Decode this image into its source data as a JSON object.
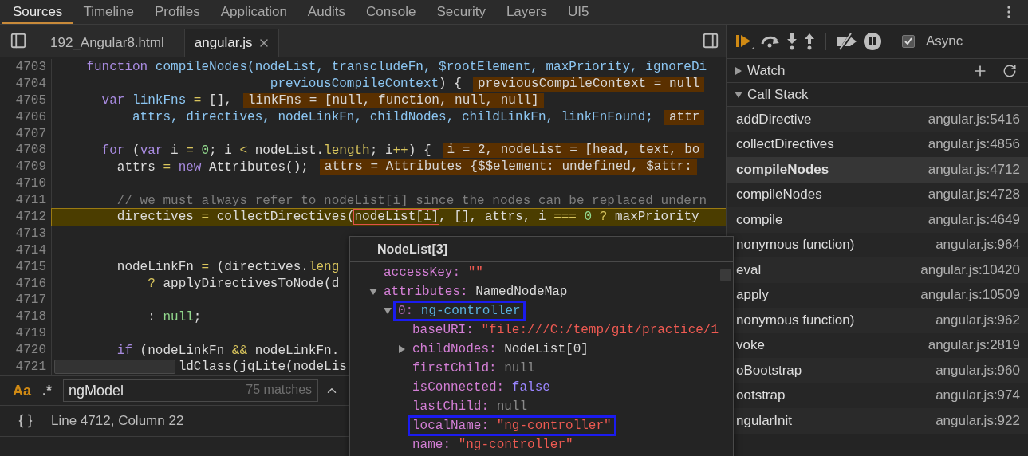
{
  "top_tabs": [
    {
      "label": "Sources",
      "selected": true
    },
    {
      "label": "Timeline",
      "selected": false
    },
    {
      "label": "Profiles",
      "selected": false
    },
    {
      "label": "Application",
      "selected": false
    },
    {
      "label": "Audits",
      "selected": false
    },
    {
      "label": "Console",
      "selected": false
    },
    {
      "label": "Security",
      "selected": false
    },
    {
      "label": "Layers",
      "selected": false
    },
    {
      "label": "UI5",
      "selected": false
    }
  ],
  "file_tabs": [
    {
      "label": "192_Angular8.html",
      "selected": false
    },
    {
      "label": "angular.js",
      "selected": true
    }
  ],
  "editor": {
    "lines": [
      {
        "number": "4703",
        "paused": false,
        "tokens": [
          {
            "kind": "kw",
            "text": "    function"
          },
          {
            "kind": "def",
            "text": " compileNodes(nodeList, transcludeFn, $rootElement, maxPriority, ignoreDi"
          }
        ]
      },
      {
        "number": "4704",
        "paused": false,
        "tokens": [
          {
            "kind": "def",
            "text": "                            previousCompileContext"
          },
          {
            "kind": "plain",
            "text": ") {"
          }
        ],
        "inline_value": "previousCompileContext = null"
      },
      {
        "number": "4705",
        "paused": false,
        "tokens": [
          {
            "kind": "kw",
            "text": "      var"
          },
          {
            "kind": "def",
            "text": " linkFns"
          },
          {
            "kind": "op",
            "text": " ="
          },
          {
            "kind": "plain",
            "text": " [],"
          }
        ],
        "inline_value": "linkFns = [null, function, null, null]"
      },
      {
        "number": "4706",
        "paused": false,
        "tokens": [
          {
            "kind": "def",
            "text": "          attrs, directives, nodeLinkFn, childNodes, childLinkFn, linkFnFound;"
          }
        ],
        "inline_value": "attr"
      },
      {
        "number": "4707",
        "paused": false
      },
      {
        "number": "4708",
        "paused": false,
        "tokens": [
          {
            "kind": "kw",
            "text": "      for"
          },
          {
            "kind": "plain",
            "text": " ("
          },
          {
            "kind": "kw",
            "text": "var"
          },
          {
            "kind": "plain",
            "text": " i "
          },
          {
            "kind": "op",
            "text": "="
          },
          {
            "kind": "num",
            "text": " 0"
          },
          {
            "kind": "plain",
            "text": "; i "
          },
          {
            "kind": "op",
            "text": "<"
          },
          {
            "kind": "plain",
            "text": " nodeList."
          },
          {
            "kind": "prop",
            "text": "length"
          },
          {
            "kind": "plain",
            "text": "; i"
          },
          {
            "kind": "op",
            "text": "++"
          },
          {
            "kind": "plain",
            "text": ") {"
          }
        ],
        "inline_value": "i = 2, nodeList = [head, text, bo"
      },
      {
        "number": "4709",
        "paused": false,
        "tokens": [
          {
            "kind": "plain",
            "text": "        attrs "
          },
          {
            "kind": "op",
            "text": "="
          },
          {
            "kind": "kw",
            "text": " new"
          },
          {
            "kind": "plain",
            "text": " Attributes();"
          }
        ],
        "inline_value": "attrs = Attributes {$$element: undefined, $attr:"
      },
      {
        "number": "4710",
        "paused": false
      },
      {
        "number": "4711",
        "paused": false,
        "tokens": [
          {
            "kind": "cmt",
            "text": "        // we must always refer to nodeList[i] since the nodes can be replaced undern"
          }
        ]
      },
      {
        "number": "4712",
        "paused": true,
        "tokens": [
          {
            "kind": "plain",
            "text": "        directives "
          },
          {
            "kind": "op",
            "text": "="
          },
          {
            "kind": "plain",
            "text": " collectDirectives("
          },
          {
            "kind": "hover",
            "text": "nodeList[i]"
          },
          {
            "kind": "plain",
            "text": ", [], attrs, i "
          },
          {
            "kind": "op",
            "text": "==="
          },
          {
            "kind": "num",
            "text": " 0"
          },
          {
            "kind": "op",
            "text": " ?"
          },
          {
            "kind": "plain",
            "text": " maxPriority"
          }
        ]
      },
      {
        "number": "4713",
        "paused": false
      },
      {
        "number": "4714",
        "paused": false
      },
      {
        "number": "4715",
        "paused": false,
        "tokens": [
          {
            "kind": "plain",
            "text": "        nodeLinkFn "
          },
          {
            "kind": "op",
            "text": "="
          },
          {
            "kind": "plain",
            "text": " (directives."
          },
          {
            "kind": "prop",
            "text": "leng"
          }
        ]
      },
      {
        "number": "4716",
        "paused": false,
        "tokens": [
          {
            "kind": "op",
            "text": "            ?"
          },
          {
            "kind": "plain",
            "text": " applyDirectivesToNode(d"
          }
        ]
      },
      {
        "number": "4717",
        "paused": false
      },
      {
        "number": "4718",
        "paused": false,
        "tokens": [
          {
            "kind": "plain",
            "text": "            : "
          },
          {
            "kind": "lit",
            "text": "null"
          },
          {
            "kind": "plain",
            "text": ";"
          }
        ]
      },
      {
        "number": "4719",
        "paused": false
      },
      {
        "number": "4720",
        "paused": false,
        "tokens": [
          {
            "kind": "kw",
            "text": "        if"
          },
          {
            "kind": "plain",
            "text": " (nodeLinkFn "
          },
          {
            "kind": "op",
            "text": "&&"
          },
          {
            "kind": "plain",
            "text": " nodeLinkFn."
          }
        ]
      },
      {
        "number": "4721",
        "paused": false,
        "tokens": [
          {
            "kind": "plain",
            "text": "                ldClass(jqLite(nodeLis"
          }
        ]
      }
    ]
  },
  "search": {
    "case_label": "Aa",
    "case_sensitive": true,
    "regex_label": ".*",
    "regex": false,
    "value": "ngModel",
    "match_count": "75 matches"
  },
  "status_bar": {
    "position": "Line 4712, Column 22"
  },
  "debugger": {
    "async": {
      "label": "Async",
      "checked": true
    },
    "sections": [
      {
        "kind": "watch",
        "title": "Watch",
        "expanded": false
      },
      {
        "kind": "call_stack",
        "title": "Call Stack",
        "expanded": true
      }
    ],
    "call_stack": [
      {
        "name": "addDirective",
        "location": "angular.js:5416",
        "selected": false
      },
      {
        "name": "collectDirectives",
        "location": "angular.js:4856",
        "selected": false
      },
      {
        "name": "compileNodes",
        "location": "angular.js:4712",
        "selected": true
      },
      {
        "name": "compileNodes",
        "location": "angular.js:4728",
        "selected": false
      },
      {
        "name": "compile",
        "location": "angular.js:4649",
        "selected": false
      },
      {
        "name": "nonymous function)",
        "location": "angular.js:964",
        "selected": false
      },
      {
        "name": "eval",
        "location": "angular.js:10420",
        "selected": false
      },
      {
        "name": "apply",
        "location": "angular.js:10509",
        "selected": false
      },
      {
        "name": "nonymous function)",
        "location": "angular.js:962",
        "selected": false
      },
      {
        "name": "voke",
        "location": "angular.js:2819",
        "selected": false
      },
      {
        "name": "oBootstrap",
        "location": "angular.js:960",
        "selected": false
      },
      {
        "name": "ootstrap",
        "location": "angular.js:974",
        "selected": false
      },
      {
        "name": "ngularInit",
        "location": "angular.js:922",
        "selected": false
      }
    ]
  },
  "popover": {
    "title": "NodeList[3]",
    "properties": [
      {
        "key": "accessKey:",
        "value": "\"\"",
        "kind": "string",
        "highlighted": false
      },
      {
        "key": "attributes:",
        "value": "NamedNodeMap",
        "kind": "object",
        "highlighted": false,
        "expanded": true,
        "children": [
          {
            "key": "0:",
            "value": "ng-controller",
            "kind": "node",
            "highlighted": true,
            "expanded": true,
            "children": [
              {
                "key": "baseURI:",
                "value": "\"file:///C:/temp/git/practice/1",
                "kind": "string",
                "highlighted": false
              },
              {
                "key": "childNodes:",
                "value": "NodeList[0]",
                "kind": "object",
                "highlighted": false,
                "expanded": false
              },
              {
                "key": "firstChild:",
                "value": "null",
                "kind": "null",
                "highlighted": false
              },
              {
                "key": "isConnected:",
                "value": "false",
                "kind": "boolean",
                "highlighted": false
              },
              {
                "key": "lastChild:",
                "value": "null",
                "kind": "null",
                "highlighted": false
              },
              {
                "key": "localName:",
                "value": "\"ng-controller\"",
                "kind": "string",
                "highlighted": true
              },
              {
                "key": "name:",
                "value": "\"ng-controller\"",
                "kind": "string",
                "highlighted": false
              }
            ]
          }
        ]
      }
    ]
  }
}
